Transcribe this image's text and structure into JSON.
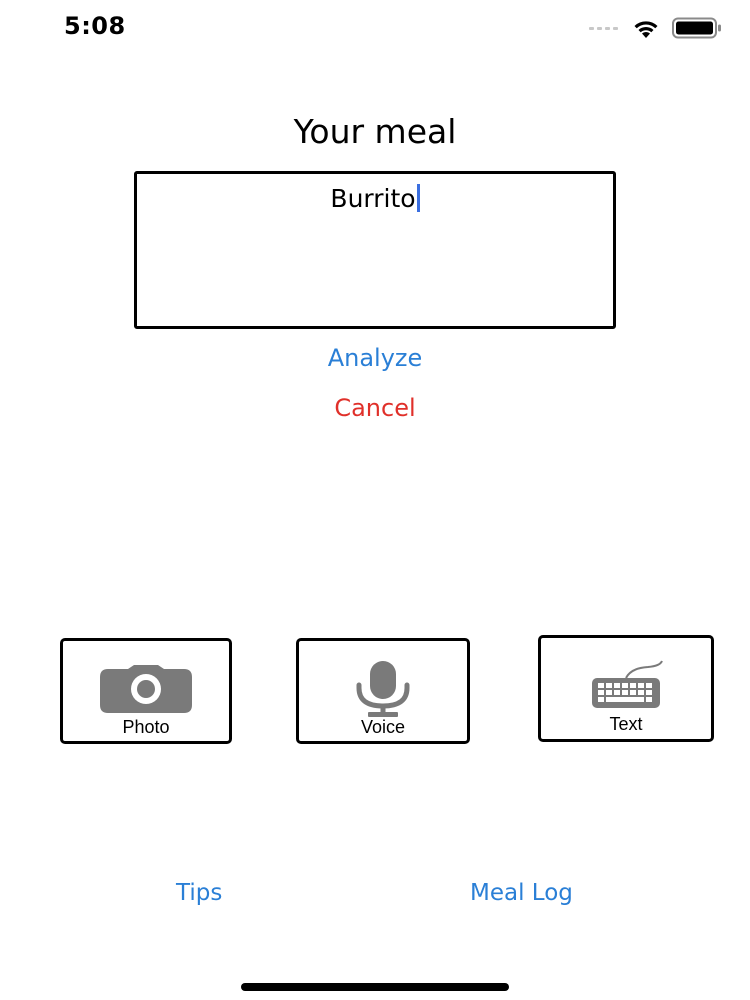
{
  "status_bar": {
    "time": "5:08",
    "icons": [
      "cellular-signal-icon",
      "wifi-icon",
      "battery-icon"
    ]
  },
  "title": "Your meal",
  "meal_input": {
    "value": "Burrito"
  },
  "actions": {
    "analyze": "Analyze",
    "cancel": "Cancel"
  },
  "input_modes": [
    {
      "label": "Photo",
      "icon": "camera-icon"
    },
    {
      "label": "Voice",
      "icon": "microphone-icon"
    },
    {
      "label": "Text",
      "icon": "keyboard-icon"
    }
  ],
  "bottom_nav": {
    "tips": "Tips",
    "meal_log": "Meal Log"
  },
  "colors": {
    "link_blue": "#2a7fd6",
    "cancel_red": "#e0302a",
    "icon_gray": "#7a7a7a",
    "caret_blue": "#3b6fe0"
  }
}
